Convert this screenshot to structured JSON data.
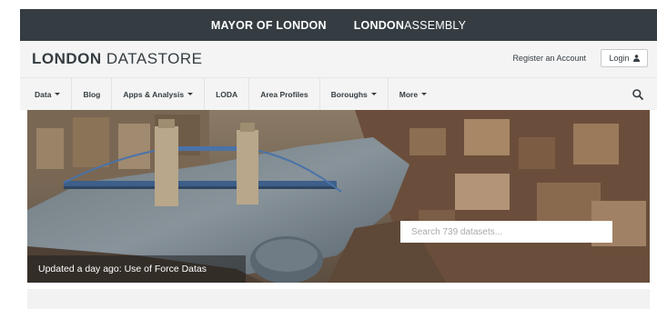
{
  "topbar": {
    "mayor": "MAYOR OF LONDON",
    "assembly_bold": "LONDON",
    "assembly_light": "ASSEMBLY"
  },
  "brand": {
    "bold": "LONDON",
    "light": " DATASTORE"
  },
  "account": {
    "register": "Register an Account",
    "login": "Login"
  },
  "nav": [
    {
      "label": "Data",
      "dropdown": true
    },
    {
      "label": "Blog",
      "dropdown": false
    },
    {
      "label": "Apps & Analysis",
      "dropdown": true
    },
    {
      "label": "LODA",
      "dropdown": false
    },
    {
      "label": "Area Profiles",
      "dropdown": false
    },
    {
      "label": "Boroughs",
      "dropdown": true
    },
    {
      "label": "More",
      "dropdown": true
    }
  ],
  "hero": {
    "search_placeholder": "Search 739 datasets...",
    "ticker": "Updated a day ago: Use of Force Datas"
  },
  "colors": {
    "dark": "#353d42",
    "light_bar": "#f4f4f4"
  }
}
